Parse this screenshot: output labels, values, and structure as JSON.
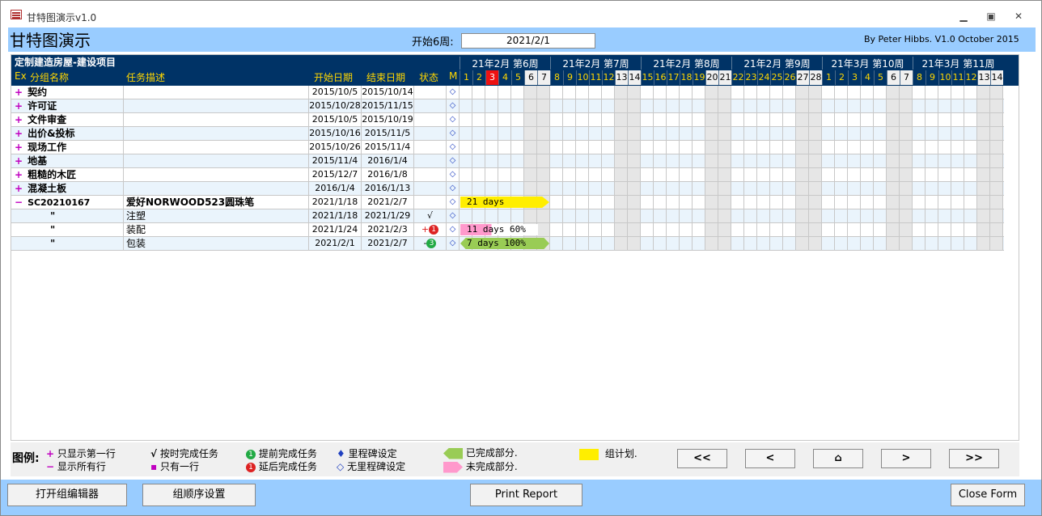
{
  "window": {
    "title": "甘特图演示v1.0",
    "minimize": "▭",
    "restore": "▭",
    "close": "✕"
  },
  "header": {
    "heading": "甘特图演示",
    "start_label": "开始6周:",
    "start_value": "2021/2/1",
    "credits": "By Peter Hibbs.  V1.0  October 2015"
  },
  "table": {
    "project_title": "定制建造房屋-建设项目",
    "columns": {
      "ex": "Ex",
      "group": "分组名称",
      "desc": "任务描述",
      "start": "开始日期",
      "end": "结束日期",
      "status": "状态",
      "m": "M"
    },
    "weeks": [
      "21年2月 第6周",
      "21年2月 第7周",
      "21年2月 第8周",
      "21年2月 第9周",
      "21年3月 第10周",
      "21年3月 第11周"
    ],
    "days": [
      "1",
      "2",
      "3",
      "4",
      "5",
      "6",
      "7",
      "8",
      "9",
      "10",
      "11",
      "12",
      "13",
      "14",
      "15",
      "16",
      "17",
      "18",
      "19",
      "20",
      "21",
      "22",
      "23",
      "24",
      "25",
      "26",
      "27",
      "28",
      "1",
      "2",
      "3",
      "4",
      "5",
      "6",
      "7",
      "8",
      "9",
      "10",
      "11",
      "12",
      "13",
      "14"
    ],
    "today_index": 2,
    "rows": [
      {
        "exp": "+",
        "name": "契约",
        "desc": "",
        "start": "2015/10/5",
        "end": "2015/10/14",
        "status": "",
        "m": "◇"
      },
      {
        "exp": "+",
        "name": "许可证",
        "desc": "",
        "start": "2015/10/28",
        "end": "2015/11/15",
        "status": "",
        "m": "◇"
      },
      {
        "exp": "+",
        "name": "文件审查",
        "desc": "",
        "start": "2015/10/5",
        "end": "2015/10/19",
        "status": "",
        "m": "◇"
      },
      {
        "exp": "+",
        "name": "出价&投标",
        "desc": "",
        "start": "2015/10/16",
        "end": "2015/11/5",
        "status": "",
        "m": "◇"
      },
      {
        "exp": "+",
        "name": "现场工作",
        "desc": "",
        "start": "2015/10/26",
        "end": "2015/11/4",
        "status": "",
        "m": "◇"
      },
      {
        "exp": "+",
        "name": "地基",
        "desc": "",
        "start": "2015/11/4",
        "end": "2016/1/4",
        "status": "",
        "m": "◇"
      },
      {
        "exp": "+",
        "name": "粗糙的木匠",
        "desc": "",
        "start": "2015/12/7",
        "end": "2016/1/8",
        "status": "",
        "m": "◇"
      },
      {
        "exp": "+",
        "name": "混凝土板",
        "desc": "",
        "start": "2016/1/4",
        "end": "2016/1/13",
        "status": "",
        "m": "◇"
      },
      {
        "exp": "−",
        "name": "SC20210167",
        "desc": "爱好NORWOOD523圆珠笔",
        "start": "2021/1/18",
        "end": "2021/2/7",
        "status": "",
        "m": "◇",
        "bar_text": "21 days"
      },
      {
        "exp": "",
        "name": "\"",
        "desc": "注塑",
        "start": "2021/1/18",
        "end": "2021/1/29",
        "status": "√",
        "m": "◇"
      },
      {
        "exp": "",
        "name": "\"",
        "desc": "装配",
        "start": "2021/1/24",
        "end": "2021/2/3",
        "status": "+",
        "status_badge": "1",
        "m": "◇",
        "bar_text": "11 days  60%",
        "progress": 0.6
      },
      {
        "exp": "",
        "name": "\"",
        "desc": "包装",
        "start": "2021/2/1",
        "end": "2021/2/7",
        "status": "-",
        "status_badge": "3",
        "m": "◇",
        "bar_text": "7 days 100%",
        "progress": 1.0
      }
    ]
  },
  "legend": {
    "title": "图例:",
    "items": [
      {
        "sym": "+",
        "text": "只显示第一行"
      },
      {
        "sym": "−",
        "text": "显示所有行"
      },
      {
        "sym": "√",
        "text": "按时完成任务"
      },
      {
        "sym": "▪",
        "text": "只有一行"
      },
      {
        "sym": "1",
        "text": "提前完成任务"
      },
      {
        "sym": "1",
        "text": "延后完成任务"
      },
      {
        "sym": "♦",
        "text": "里程碑设定"
      },
      {
        "sym": "◇",
        "text": "无里程碑设定"
      },
      {
        "sym": "",
        "text": "已完成部分."
      },
      {
        "sym": "",
        "text": "未完成部分."
      },
      {
        "sym": "",
        "text": "组计划."
      }
    ],
    "nav": [
      "<<",
      "<",
      "⌂",
      ">",
      ">>"
    ]
  },
  "footer": {
    "open_group_editor": "打开组编辑器",
    "group_order": "组顺序设置",
    "print_report": "Print Report",
    "close_form": "Close Form"
  },
  "colors": {
    "group_bar": "#ffee00",
    "done": "#99cc55",
    "pending": "#ff99cc",
    "header_bg": "#003366",
    "accent": "#99ccff"
  }
}
